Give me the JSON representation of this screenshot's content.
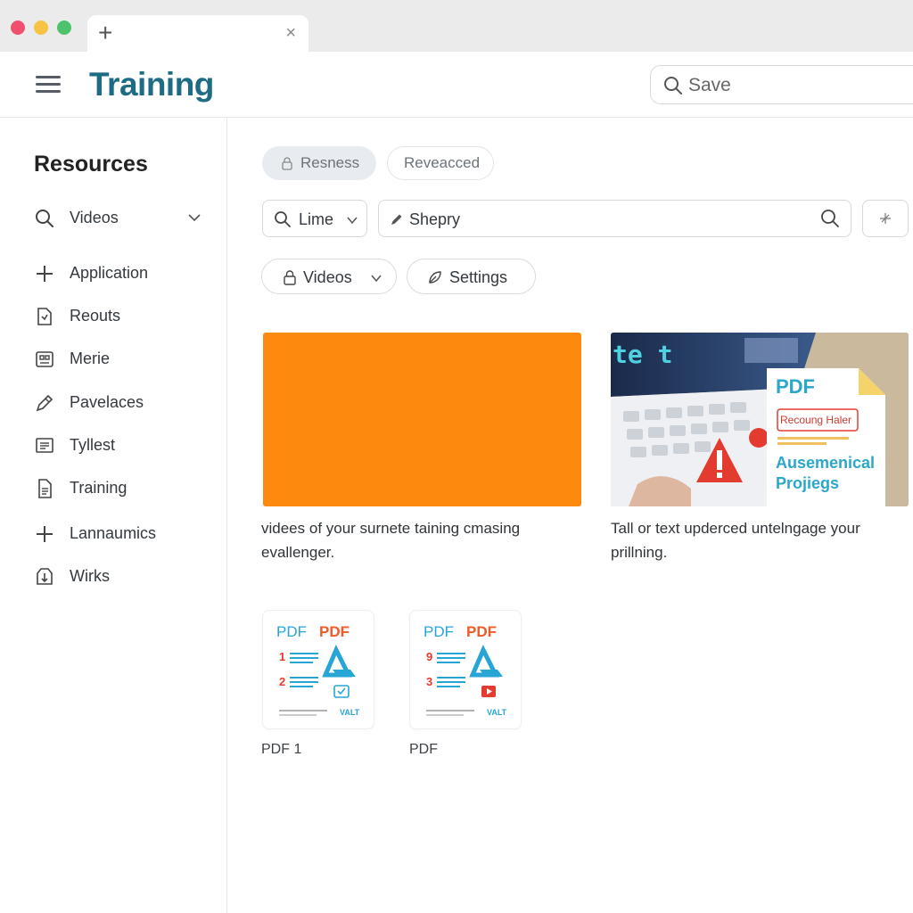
{
  "browser": {
    "new_tab_symbol": "+",
    "close_symbol": "×"
  },
  "header": {
    "title": "Training",
    "search_placeholder": "Save"
  },
  "sidebar": {
    "title": "Resources",
    "items": [
      {
        "label": "Videos",
        "icon": "search-icon"
      },
      {
        "label": "Application",
        "icon": "plus-icon"
      },
      {
        "label": "Reouts",
        "icon": "document-icon"
      },
      {
        "label": "Merie",
        "icon": "grid-icon"
      },
      {
        "label": "Pavelaces",
        "icon": "pencil-icon"
      },
      {
        "label": "Tyllest",
        "icon": "list-icon"
      },
      {
        "label": "Training",
        "icon": "file-icon"
      },
      {
        "label": "Lannaumics",
        "icon": "plus-icon"
      },
      {
        "label": "Wirks",
        "icon": "upload-icon"
      }
    ]
  },
  "main": {
    "tabs": [
      {
        "label": "Resness"
      },
      {
        "label": "Reveacced"
      }
    ],
    "filters": {
      "dropdown_label": "Lime",
      "search_value": "Shepry"
    },
    "chips": [
      {
        "label": "Videos"
      },
      {
        "label": "Settings"
      }
    ],
    "cards": [
      {
        "text": "videes of your surnete taining cmasing evallenger.",
        "color": "#fb8a0e"
      },
      {
        "text": "Tall or text upderced untelngage your prillning."
      }
    ],
    "card2_overlay": {
      "screen_text": "te t",
      "doc_title": "PDF",
      "doc_tag": "Recoung Haler",
      "doc_heading_1": "Ausemenical",
      "doc_heading_2": "Projiegs"
    },
    "pdfs": [
      {
        "caption": "PDF 1",
        "label_a": "PDF",
        "label_b": "PDF",
        "num_1": "1",
        "num_2": "2",
        "footer": "VALT"
      },
      {
        "caption": "PDF",
        "label_a": "PDF",
        "label_b": "PDF",
        "num_1": "9",
        "num_2": "3",
        "footer": "VALT"
      }
    ]
  }
}
